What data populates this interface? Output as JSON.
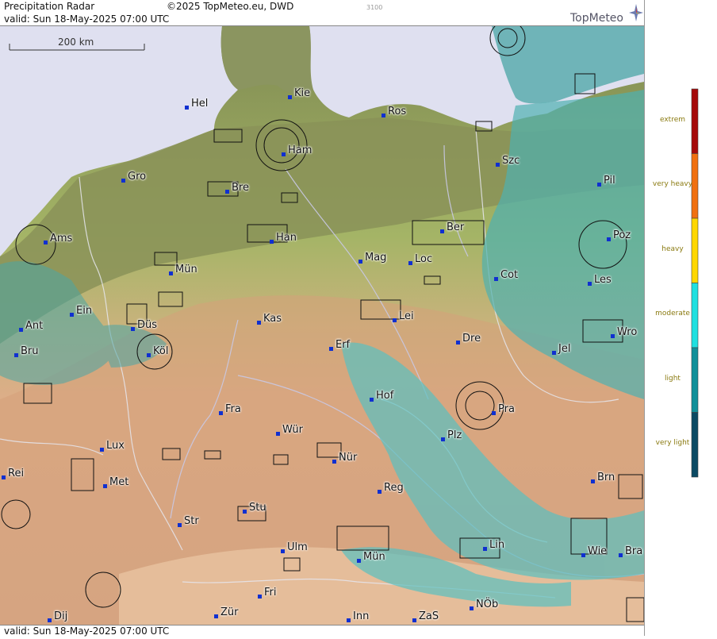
{
  "header": {
    "title": "Precipitation Radar",
    "copyright": "©2025 TopMeteo.eu, DWD",
    "code": "3100",
    "valid": "valid:  Sun  18-May-2025 07:00 UTC",
    "logo": "TopMeteo"
  },
  "scale_bar": {
    "label": "200 km"
  },
  "footer": {
    "valid": "valid:  Sun  18-May-2025 07:00 UTC"
  },
  "legend": {
    "levels": [
      {
        "label": "extrem",
        "color": "#a50a0a"
      },
      {
        "label": "very heavy",
        "color": "#f07010"
      },
      {
        "label": "heavy",
        "color": "#ffd700"
      },
      {
        "label": "moderate",
        "color": "#20e0e0"
      },
      {
        "label": "light",
        "color": "#12909a"
      },
      {
        "label": "very light",
        "color": "#0b4a63"
      }
    ]
  },
  "colors": {
    "sea": "#dedff0",
    "lowland": "#8e9a5a",
    "plain": "#a8b868",
    "upland": "#d9ab84",
    "radar_light": "#4aa8a8",
    "radar_moderate": "#5ad0d0"
  },
  "cities": [
    {
      "id": "hel",
      "name": "Hel"
    },
    {
      "id": "kie",
      "name": "Kie"
    },
    {
      "id": "ros",
      "name": "Ros"
    },
    {
      "id": "ham",
      "name": "Ham"
    },
    {
      "id": "szc",
      "name": "Szc"
    },
    {
      "id": "gro",
      "name": "Gro"
    },
    {
      "id": "bre",
      "name": "Bre"
    },
    {
      "id": "pil",
      "name": "Pil"
    },
    {
      "id": "ams",
      "name": "Ams"
    },
    {
      "id": "han",
      "name": "Han"
    },
    {
      "id": "ber",
      "name": "Ber"
    },
    {
      "id": "poz",
      "name": "Poz"
    },
    {
      "id": "mag",
      "name": "Mag"
    },
    {
      "id": "loc",
      "name": "Loc"
    },
    {
      "id": "mun",
      "name": "Mün"
    },
    {
      "id": "cot",
      "name": "Cot"
    },
    {
      "id": "les",
      "name": "Les"
    },
    {
      "id": "ein",
      "name": "Ein"
    },
    {
      "id": "kas",
      "name": "Kas"
    },
    {
      "id": "lei",
      "name": "Lei"
    },
    {
      "id": "ant",
      "name": "Ant"
    },
    {
      "id": "dus",
      "name": "Düs"
    },
    {
      "id": "dre",
      "name": "Dre"
    },
    {
      "id": "wro",
      "name": "Wro"
    },
    {
      "id": "bru",
      "name": "Bru"
    },
    {
      "id": "kol",
      "name": "Köl"
    },
    {
      "id": "erf",
      "name": "Erf"
    },
    {
      "id": "jel",
      "name": "Jel"
    },
    {
      "id": "hof",
      "name": "Hof"
    },
    {
      "id": "fra",
      "name": "Fra"
    },
    {
      "id": "pra",
      "name": "Pra"
    },
    {
      "id": "wur",
      "name": "Wür"
    },
    {
      "id": "lux",
      "name": "Lux"
    },
    {
      "id": "plz",
      "name": "Plz"
    },
    {
      "id": "nur",
      "name": "Nür"
    },
    {
      "id": "rei",
      "name": "Rei"
    },
    {
      "id": "brn",
      "name": "Brn"
    },
    {
      "id": "met",
      "name": "Met"
    },
    {
      "id": "reg",
      "name": "Reg"
    },
    {
      "id": "stu",
      "name": "Stu"
    },
    {
      "id": "str",
      "name": "Str"
    },
    {
      "id": "ulm",
      "name": "Ulm"
    },
    {
      "id": "lin",
      "name": "Lin"
    },
    {
      "id": "mun2",
      "name": "Mün"
    },
    {
      "id": "wie",
      "name": "Wie"
    },
    {
      "id": "bra",
      "name": "Bra"
    },
    {
      "id": "fri",
      "name": "Fri"
    },
    {
      "id": "nob",
      "name": "NÖb"
    },
    {
      "id": "dij",
      "name": "Dij"
    },
    {
      "id": "zur",
      "name": "Zür"
    },
    {
      "id": "inn",
      "name": "Inn"
    },
    {
      "id": "zas",
      "name": "ZaS"
    }
  ]
}
